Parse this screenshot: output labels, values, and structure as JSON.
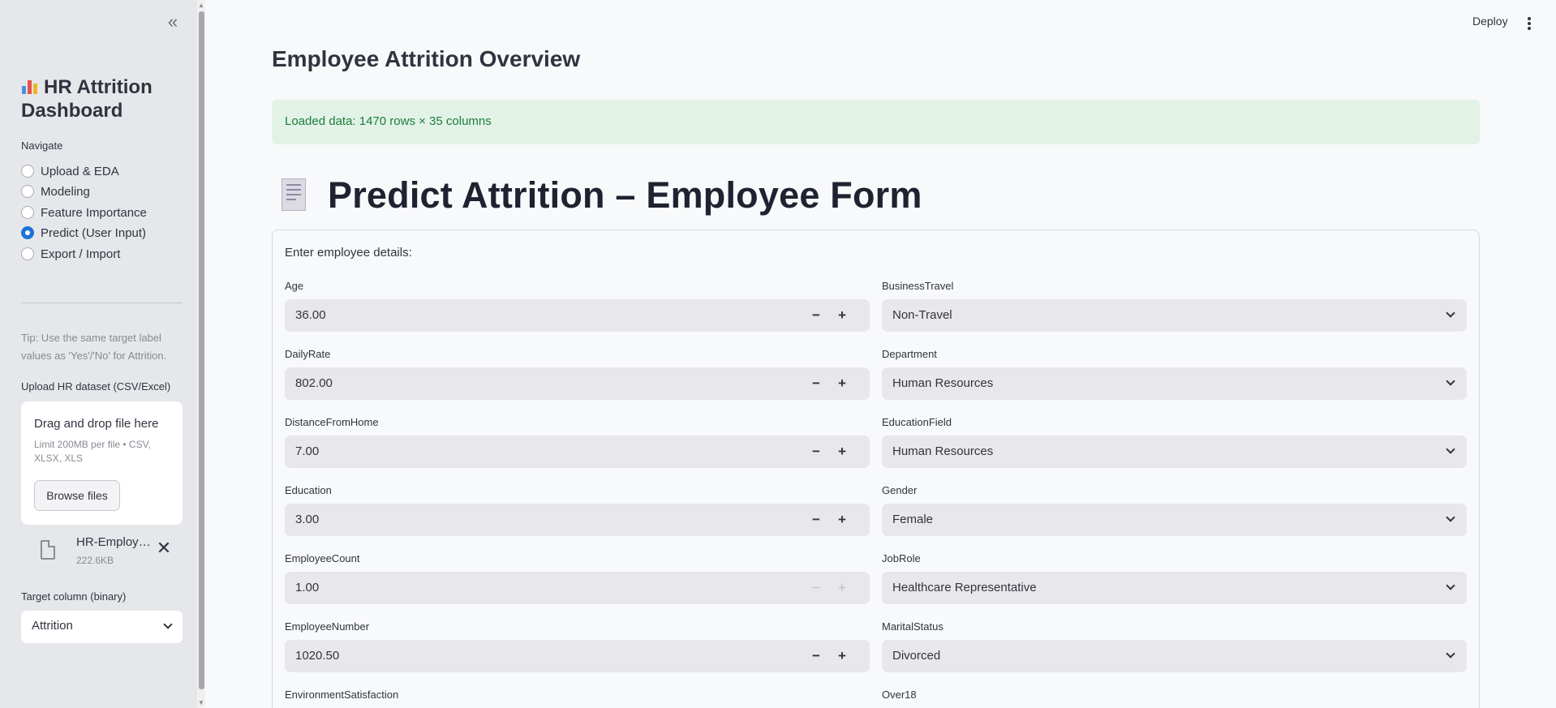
{
  "sidebar": {
    "title": "HR Attrition Dashboard",
    "nav_label": "Navigate",
    "nav_items": [
      {
        "label": "Upload & EDA",
        "selected": false
      },
      {
        "label": "Modeling",
        "selected": false
      },
      {
        "label": "Feature Importance",
        "selected": false
      },
      {
        "label": "Predict (User Input)",
        "selected": true
      },
      {
        "label": "Export / Import",
        "selected": false
      }
    ],
    "tip": "Tip: Use the same target label values as 'Yes'/'No' for Attrition.",
    "upload_label": "Upload HR dataset (CSV/Excel)",
    "dropzone_title": "Drag and drop file here",
    "dropzone_sub": "Limit 200MB per file • CSV, XLSX, XLS",
    "browse_label": "Browse files",
    "file_name": "HR-Employee-Attrition.csv",
    "file_size": "222.6KB",
    "target_label": "Target column (binary)",
    "target_value": "Attrition"
  },
  "header": {
    "deploy_label": "Deploy"
  },
  "main": {
    "page_title": "Employee Attrition Overview",
    "alert": "Loaded data: 1470 rows × 35 columns",
    "form_title": "Predict Attrition – Employee Form",
    "form_intro": "Enter employee details:",
    "left_fields": [
      {
        "label": "Age",
        "value": "36.00"
      },
      {
        "label": "DailyRate",
        "value": "802.00"
      },
      {
        "label": "DistanceFromHome",
        "value": "7.00"
      },
      {
        "label": "Education",
        "value": "3.00"
      },
      {
        "label": "EmployeeCount",
        "value": "1.00"
      },
      {
        "label": "EmployeeNumber",
        "value": "1020.50"
      },
      {
        "label": "EnvironmentSatisfaction",
        "value": ""
      }
    ],
    "right_fields": [
      {
        "label": "BusinessTravel",
        "value": "Non-Travel"
      },
      {
        "label": "Department",
        "value": "Human Resources"
      },
      {
        "label": "EducationField",
        "value": "Human Resources"
      },
      {
        "label": "Gender",
        "value": "Female"
      },
      {
        "label": "JobRole",
        "value": "Healthcare Representative"
      },
      {
        "label": "MaritalStatus",
        "value": "Divorced"
      },
      {
        "label": "Over18",
        "value": ""
      }
    ]
  },
  "colors": {
    "accent": "#1c74d4",
    "success_bg": "#e3f2e6",
    "success_text": "#1b7d3c",
    "sidebar_bg": "#e6e7ea"
  }
}
